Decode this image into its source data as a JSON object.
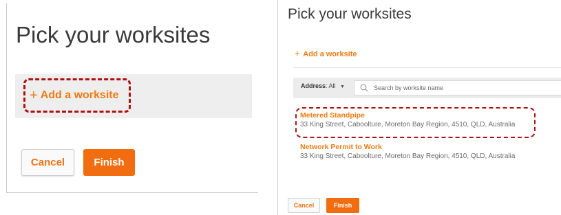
{
  "colors": {
    "accent": "#f07a12",
    "finish_bg": "#f26d10",
    "highlight": "#b00f0f",
    "bar_bg": "#eeeeee"
  },
  "left_panel": {
    "title": "Pick your worksites",
    "add_link": {
      "icon": "plus-icon",
      "label": "Add a worksite"
    },
    "cancel_label": "Cancel",
    "finish_label": "Finish"
  },
  "right_panel": {
    "title": "Pick your worksites",
    "add_link": {
      "icon": "plus-icon",
      "label": "Add a worksite"
    },
    "filter": {
      "address_label": "Address",
      "address_value": ": All",
      "dropdown_icon": "chevron-down-icon",
      "search_icon": "search-icon",
      "search_placeholder": "Search by worksite name"
    },
    "worksites": [
      {
        "name": "Metered Standpipe",
        "address": "33 King Street, Caboolture, Moreton Bay Region, 4510, QLD, Australia"
      },
      {
        "name": "Network Permit to Work",
        "address": "33 King Street, Caboolture, Moreton Bay Region, 4510, QLD, Australia"
      }
    ],
    "cancel_label": "Cancel",
    "finish_label": "Finish"
  }
}
